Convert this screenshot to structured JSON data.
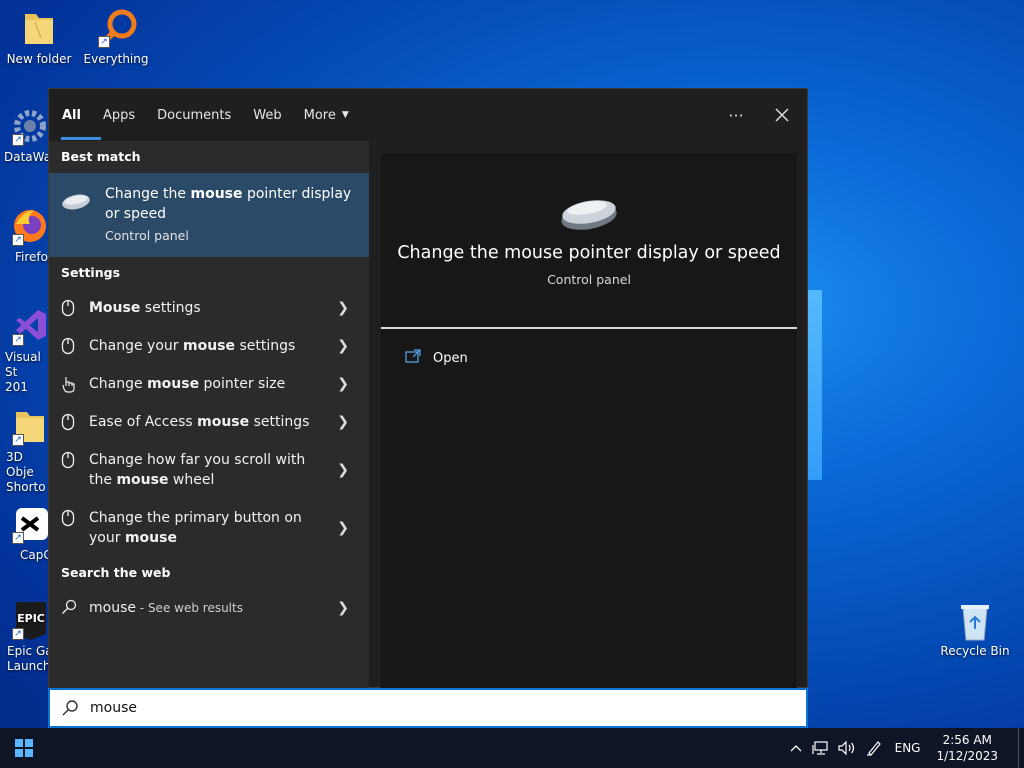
{
  "desktop": {
    "icons": [
      {
        "label": "New folder"
      },
      {
        "label": "Everything"
      },
      {
        "label": "DataWag"
      },
      {
        "label": "Firefo"
      },
      {
        "label": "Visual St\n201"
      },
      {
        "label": "3D Obje\nShorto"
      },
      {
        "label": "CapC"
      },
      {
        "label": "Epic Ga\nLaunch"
      },
      {
        "label": "Recycle Bin"
      }
    ]
  },
  "search_panel": {
    "tabs": [
      "All",
      "Apps",
      "Documents",
      "Web",
      "More"
    ],
    "active_tab": "All",
    "best_match": {
      "heading": "Best match",
      "title_pre": "Change the ",
      "title_bold": "mouse",
      "title_post": " pointer display or speed",
      "subtitle": "Control panel"
    },
    "settings": {
      "heading": "Settings",
      "items": [
        {
          "pre": "",
          "bold": "Mouse",
          "post": " settings"
        },
        {
          "pre": "Change your ",
          "bold": "mouse",
          "post": " settings"
        },
        {
          "pre": "Change ",
          "bold": "mouse",
          "post": " pointer size"
        },
        {
          "pre": "Ease of Access ",
          "bold": "mouse",
          "post": " settings"
        },
        {
          "pre": "Change how far you scroll with the ",
          "bold": "mouse",
          "post": " wheel"
        },
        {
          "pre": "Change the primary button on your ",
          "bold": "mouse",
          "post": ""
        }
      ]
    },
    "web": {
      "heading": "Search the web",
      "query": "mouse",
      "suffix": " - See web results"
    },
    "preview": {
      "title": "Change the mouse pointer display or speed",
      "subtitle": "Control panel",
      "action": "Open"
    }
  },
  "search_box": {
    "value": "mouse"
  },
  "taskbar": {
    "language": "ENG",
    "time": "2:56 AM",
    "date": "1/12/2023"
  }
}
